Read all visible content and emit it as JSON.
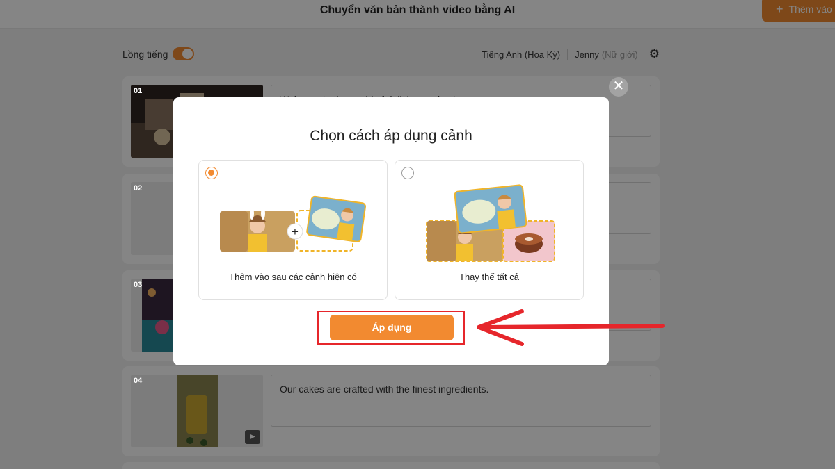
{
  "header": {
    "title": "Chuyển văn bản thành video bằng AI",
    "add_button_label": "Thêm vào",
    "add_icon": "plus-icon"
  },
  "voiceover": {
    "label": "Lồng tiếng",
    "enabled": true,
    "language": "Tiếng Anh (Hoa Kỳ)",
    "voice_name": "Jenny",
    "voice_gender": "(Nữ giới)",
    "settings_icon": "gear-icon"
  },
  "scenes": [
    {
      "number": "01",
      "text": "Welcome to the world of delicious cakes!"
    },
    {
      "number": "02",
      "text": ""
    },
    {
      "number": "03",
      "text": ""
    },
    {
      "number": "04",
      "text": "Our cakes are crafted with the finest ingredients."
    }
  ],
  "modal": {
    "title": "Chọn cách áp dụng cảnh",
    "close_icon": "close-icon",
    "options": [
      {
        "label": "Thêm vào sau các cảnh hiện có",
        "selected": true
      },
      {
        "label": "Thay thế tất cả",
        "selected": false
      }
    ],
    "apply_label": "Áp dụng"
  },
  "colors": {
    "accent": "#f28a30",
    "highlight_frame": "#e6262b",
    "dashed_border": "#f0b429"
  }
}
